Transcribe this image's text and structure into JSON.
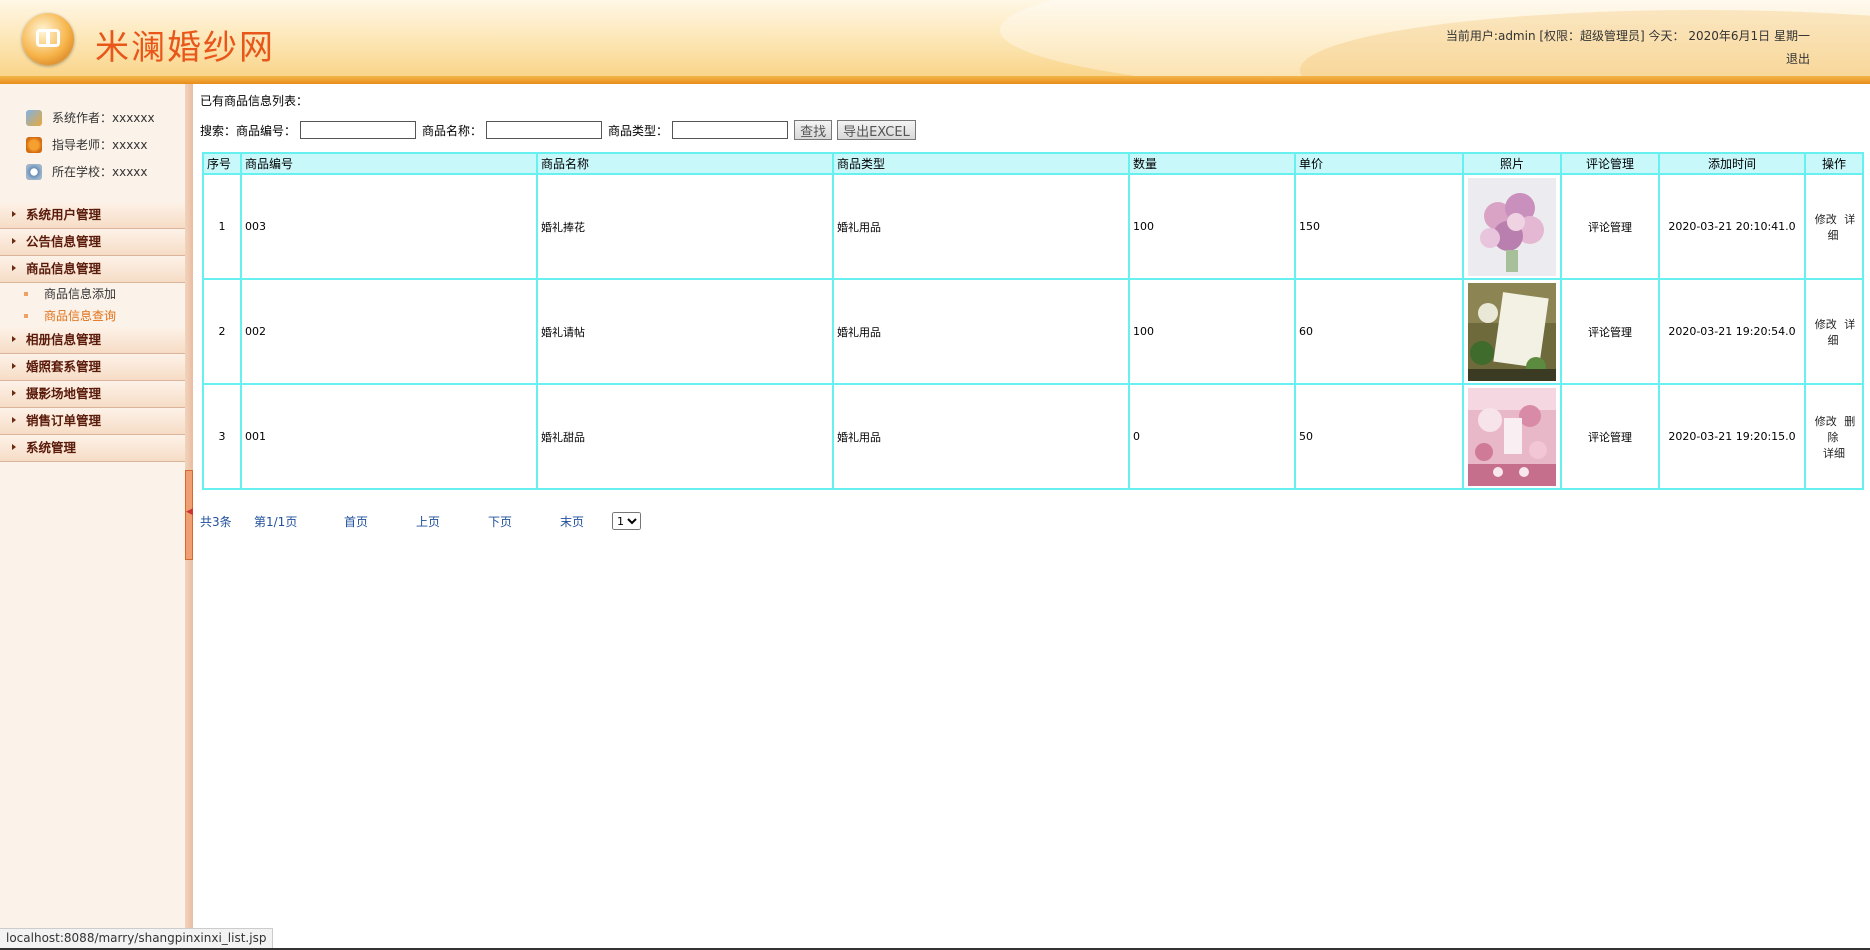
{
  "header": {
    "site_title": "米澜婚纱网",
    "user_info": "当前用户:admin [权限：超级管理员] 今天： 2020年6月1日 星期一",
    "logout": "退出"
  },
  "sidebar": {
    "info": [
      {
        "icon": "user-icon",
        "text": "系统作者：xxxxxx"
      },
      {
        "icon": "teacher-icon",
        "text": "指导老师：xxxxx"
      },
      {
        "icon": "school-icon",
        "text": "所在学校：xxxxx"
      }
    ],
    "menu": [
      "系统用户管理",
      "公告信息管理",
      "商品信息管理",
      "相册信息管理",
      "婚照套系管理",
      "摄影场地管理",
      "销售订单管理",
      "系统管理"
    ],
    "submenu": [
      "商品信息添加",
      "商品信息查询"
    ]
  },
  "main": {
    "list_title": "已有商品信息列表：",
    "search": {
      "label": "搜索：",
      "code_label": "商品编号：",
      "name_label": "商品名称：",
      "type_label": "商品类型：",
      "code_value": "",
      "name_value": "",
      "type_value": "",
      "find_button": "查找",
      "export_button": "导出EXCEL"
    },
    "columns": [
      "序号",
      "商品编号",
      "商品名称",
      "商品类型",
      "数量",
      "单价",
      "照片",
      "评论管理",
      "添加时间",
      "操作"
    ],
    "rows": [
      {
        "no": "1",
        "code": "003",
        "name": "婚礼捧花",
        "type": "婚礼用品",
        "qty": "100",
        "price": "150",
        "comment": "评论管理",
        "time": "2020-03-21 20:10:41.0",
        "ops": [
          "修改",
          "详细"
        ]
      },
      {
        "no": "2",
        "code": "002",
        "name": "婚礼请帖",
        "type": "婚礼用品",
        "qty": "100",
        "price": "60",
        "comment": "评论管理",
        "time": "2020-03-21 19:20:54.0",
        "ops": [
          "修改",
          "详细"
        ]
      },
      {
        "no": "3",
        "code": "001",
        "name": "婚礼甜品",
        "type": "婚礼用品",
        "qty": "0",
        "price": "50",
        "comment": "评论管理",
        "time": "2020-03-21 19:20:15.0",
        "ops": [
          "修改",
          "删除",
          "详细"
        ]
      }
    ],
    "pager": {
      "total": "共3条",
      "page": "第1/1页",
      "first": "首页",
      "prev": "上页",
      "next": "下页",
      "last": "末页",
      "select_value": "1"
    }
  },
  "status_url": "localhost:8088/marry/shangpinxinxi_list.jsp"
}
